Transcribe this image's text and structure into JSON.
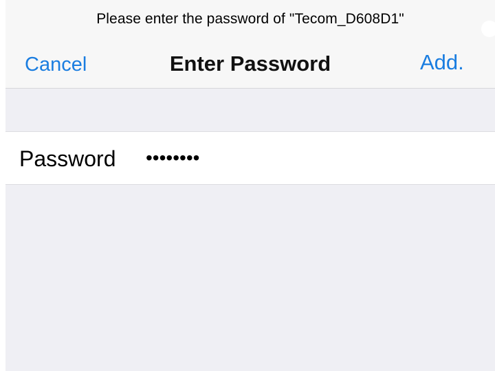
{
  "header": {
    "prompt": "Please enter the password of \"Tecom_D608D1\"",
    "cancel_label": "Cancel",
    "title": "Enter Password",
    "add_label": "Add."
  },
  "form": {
    "password_label": "Password",
    "password_value": "••••••••"
  },
  "colors": {
    "accent": "#1a7de0",
    "background": "#efeff4",
    "nav_background": "#f7f7f7",
    "field_background": "#ffffff"
  }
}
